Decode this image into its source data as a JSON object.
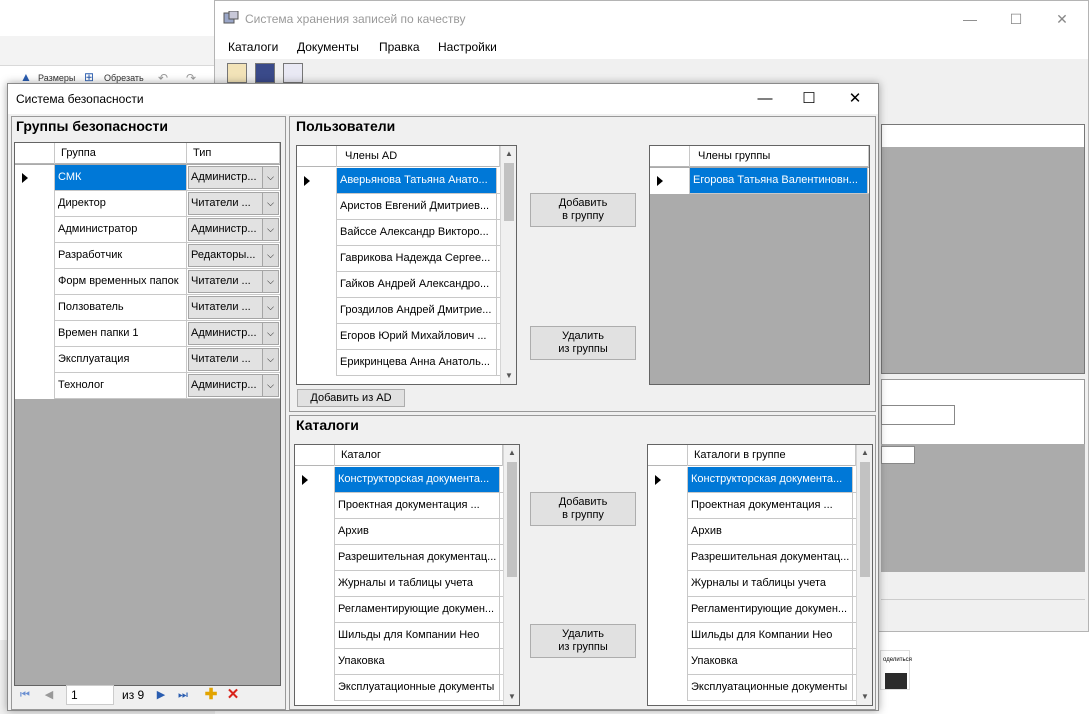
{
  "background_app": {
    "ribbon": {
      "size_label": "Размеры",
      "crop_label": "Обрезать"
    },
    "taskbar_hint": "оделиться"
  },
  "main_window": {
    "title": "Система хранения записей по качеству",
    "menu": [
      "Каталоги",
      "Документы",
      "Правка",
      "Настройки"
    ],
    "controls": {
      "minimize": "—",
      "maximize": "☐",
      "close": "✕"
    }
  },
  "dialog": {
    "title": "Система безопасности",
    "controls": {
      "minimize": "—",
      "maximize": "☐",
      "close": "✕"
    },
    "security_groups": {
      "title": "Группы безопасности",
      "columns": [
        "Группа",
        "Тип"
      ],
      "rows": [
        {
          "group": "СМК",
          "type": "Администр..."
        },
        {
          "group": "Директор",
          "type": "Читатели  ..."
        },
        {
          "group": "Администратор",
          "type": "Администр..."
        },
        {
          "group": "Разработчик",
          "type": "Редакторы..."
        },
        {
          "group": "Форм временных папок",
          "type": "Читатели  ..."
        },
        {
          "group": "Ползователь",
          "type": "Читатели  ..."
        },
        {
          "group": "Времен папки 1",
          "type": "Администр..."
        },
        {
          "group": "Эксплуатация",
          "type": "Читатели  ..."
        },
        {
          "group": "Технолог",
          "type": "Администр..."
        }
      ],
      "navigator": {
        "position": "1",
        "of": "из 9"
      }
    },
    "users": {
      "title": "Пользователи",
      "ad_header": "Члены AD",
      "ad_members": [
        "Аверьянова Татьяна Анато...",
        "Аристов Евгений Дмитриев...",
        "Вайссе Александр Викторо...",
        "Гаврикова Надежда Сергее...",
        "Гайков Андрей Александро...",
        "Гроздилов Андрей Дмитрие...",
        "Егоров Юрий Михайлович    ...",
        "Ерикринцева Анна Анатоль..."
      ],
      "group_header": "Члены группы",
      "group_members": [
        "Егорова Татьяна Валентиновн..."
      ],
      "add_button": "Добавить\nв группу",
      "remove_button": "Удалить\nиз группы",
      "add_from_ad_button": "Добавить из AD"
    },
    "catalogs": {
      "title": "Каталоги",
      "all_header": "Каталог",
      "all": [
        "Конструкторская документа...",
        "Проектная документация       ...",
        "Архив",
        "Разрешительная документац...",
        "Журналы и таблицы учета",
        "Регламентирующие докумен...",
        "Шильды для Компании Нео",
        "Упаковка",
        "Эксплуатационные документы"
      ],
      "group_header": "Каталоги в группе",
      "in_group": [
        "Конструкторская документа...",
        "Проектная документация       ...",
        "Архив",
        "Разрешительная документац...",
        "Журналы и таблицы учета",
        "Регламентирующие докумен...",
        "Шильды для Компании Нео",
        "Упаковка",
        "Эксплуатационные документы"
      ],
      "add_button": "Добавить\nв группу",
      "remove_button": "Удалить\nиз группы"
    }
  },
  "colors": {
    "selection": "#0078d7",
    "grid_bg": "#ababab",
    "window_bg": "#f0f0f0"
  }
}
